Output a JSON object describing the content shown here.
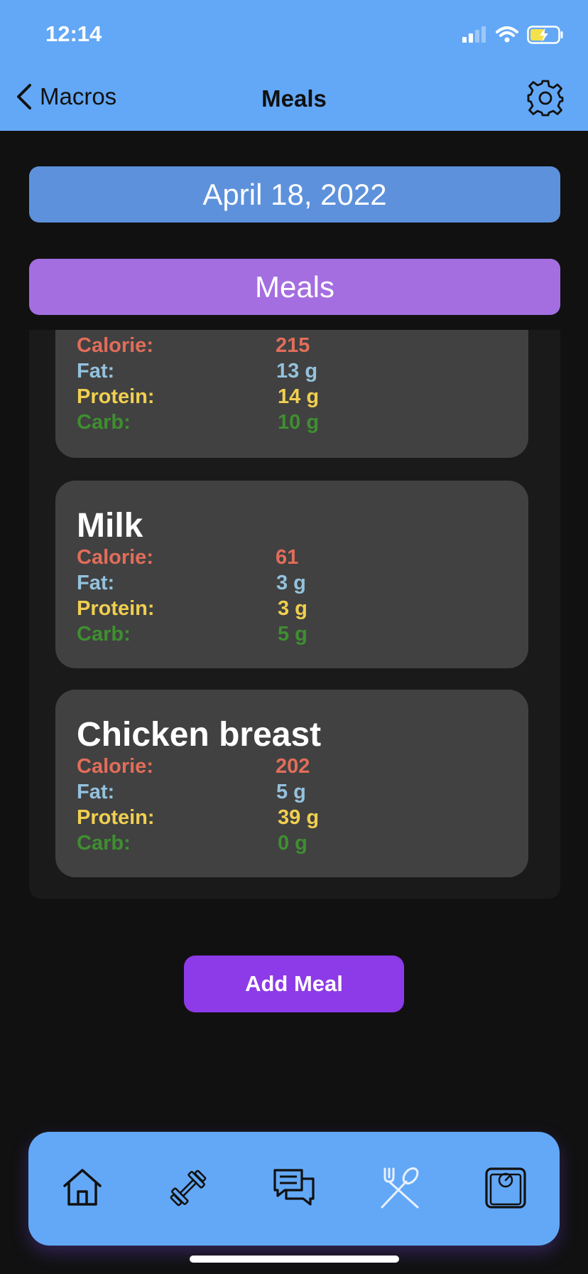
{
  "status_bar": {
    "time": "12:14"
  },
  "nav": {
    "back_label": "Macros",
    "title": "Meals"
  },
  "date_label": "April 18, 2022",
  "section_title": "Meals",
  "meals": [
    {
      "name": "",
      "calorie_label": "Calorie:",
      "calorie": "215",
      "fat_label": "Fat:",
      "fat": "13 g",
      "protein_label": "Protein:",
      "protein": "14 g",
      "carb_label": "Carb:",
      "carb": "10 g"
    },
    {
      "name": "Milk",
      "calorie_label": "Calorie:",
      "calorie": "61",
      "fat_label": "Fat:",
      "fat": "3 g",
      "protein_label": "Protein:",
      "protein": "3 g",
      "carb_label": "Carb:",
      "carb": "5 g"
    },
    {
      "name": "Chicken breast",
      "calorie_label": "Calorie:",
      "calorie": "202",
      "fat_label": "Fat:",
      "fat": "5 g",
      "protein_label": "Protein:",
      "protein": "39 g",
      "carb_label": "Carb:",
      "carb": "0 g"
    }
  ],
  "add_button_label": "Add Meal",
  "tabs": [
    {
      "icon": "home-icon"
    },
    {
      "icon": "dumbbell-icon"
    },
    {
      "icon": "chat-icon"
    },
    {
      "icon": "fork-spoon-icon"
    },
    {
      "icon": "scale-icon"
    }
  ],
  "colors": {
    "header_bg": "#63a8f6",
    "date_button": "#5d91db",
    "meals_header": "#a46ee0",
    "add_button": "#8d3ae8",
    "calorie": "#e26d5a",
    "fat": "#94c2de",
    "protein": "#f0cf4f",
    "carb": "#3f8e31"
  }
}
